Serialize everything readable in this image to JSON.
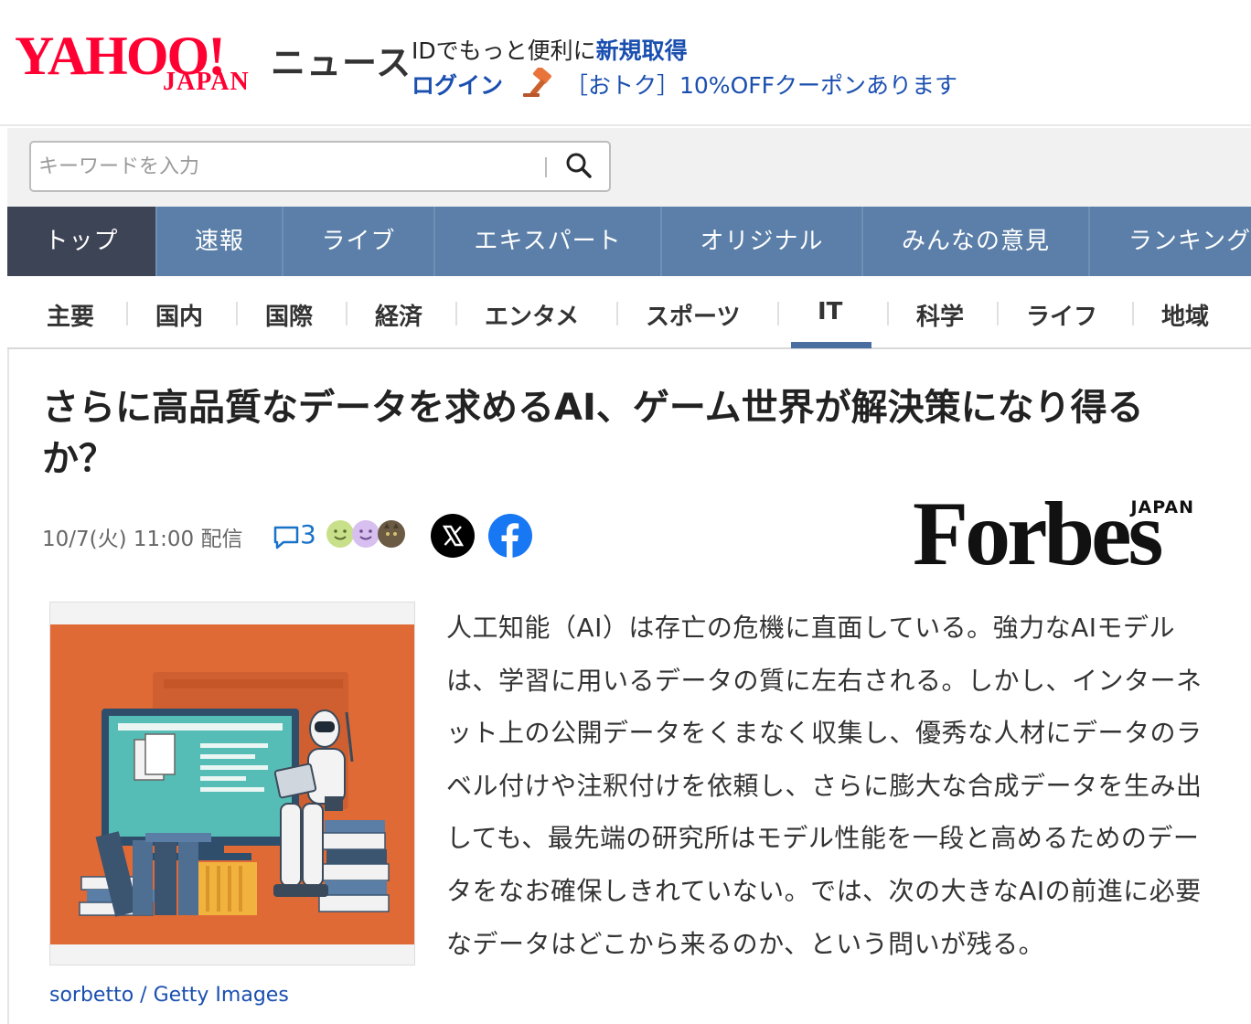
{
  "header": {
    "logo_yahoo": "YAHOO!",
    "logo_japan": "JAPAN",
    "logo_news": "ニュース",
    "promo_prefix": "IDでもっと便利に",
    "promo_link": "新規取得",
    "login": "ログイン",
    "coupon": "［おトク］10%OFFクーポンあります"
  },
  "search": {
    "placeholder": "キーワードを入力",
    "value": ""
  },
  "main_nav": [
    "トップ",
    "速報",
    "ライブ",
    "エキスパート",
    "オリジナル",
    "みんなの意見",
    "ランキング"
  ],
  "main_nav_active": "トップ",
  "sub_nav": [
    "主要",
    "国内",
    "国際",
    "経済",
    "エンタメ",
    "スポーツ",
    "IT",
    "科学",
    "ライフ",
    "地域"
  ],
  "sub_nav_active": "IT",
  "article": {
    "title": "さらに高品質なデータを求めるAI、ゲーム世界が解決策になり得るか？",
    "date": "10/7(火) 11:00 配信",
    "comment_count": "3",
    "source_japan": "JAPAN",
    "source_word": "Forbes",
    "photo_credit": "sorbetto / Getty Images",
    "body": "人工知能（AI）は存亡の危機に直面している。強力なAIモデルは、学習に用いるデータの質に左右される。しかし、インターネット上の公開データをくまなく収集し、優秀な人材にデータのラベル付けや注釈付けを依頼し、さらに膨大な合成データを生み出しても、最先端の研究所はモデル性能を一段と高めるためのデータをなお確保しきれていない。では、次の大きなAIの前進に必要なデータはどこから来るのか、という問いが残る。"
  },
  "colors": {
    "brand_red": "#ff0033",
    "link_blue": "#1a4fb0",
    "nav_blue": "#5b7fa8",
    "nav_active": "#3d4455",
    "photo_orange": "#e06a35"
  }
}
